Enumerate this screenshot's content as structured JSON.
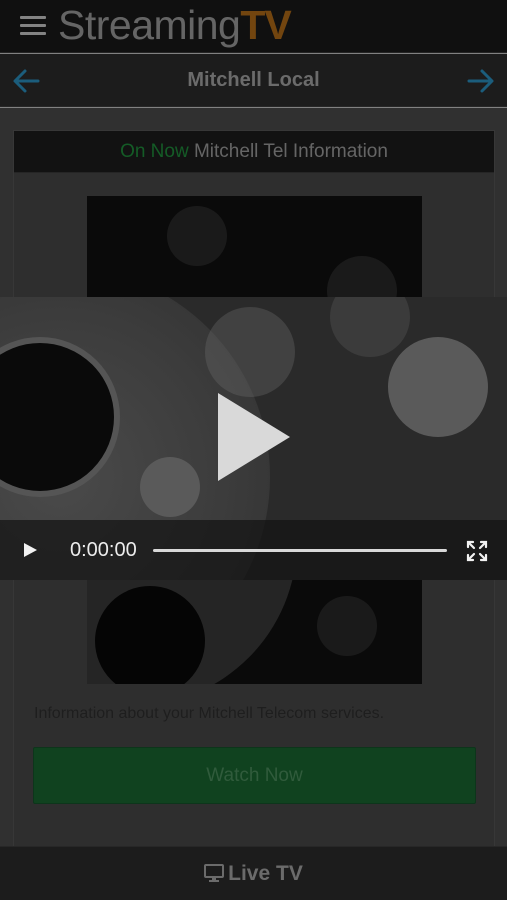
{
  "header": {
    "logo_prefix": "Streaming",
    "logo_suffix": "TV"
  },
  "nav": {
    "title": "Mitchell Local"
  },
  "card": {
    "on_now_label": "On Now",
    "program_title": "Mitchell Tel Information",
    "description": "Information about your Mitchell Telecom services.",
    "watch_button": "Watch Now"
  },
  "player": {
    "time": "0:00:00",
    "progress": 0
  },
  "footer": {
    "live_tv_label": "Live TV"
  },
  "icons": {
    "menu": "menu-icon",
    "back": "arrow-left-icon",
    "forward": "arrow-right-icon",
    "play": "play-icon",
    "fullscreen": "fullscreen-icon",
    "tv": "tv-icon"
  },
  "colors": {
    "logo_accent": "#b06b18",
    "on_now": "#1f8c3b",
    "watch_button": "#1a6630",
    "nav_arrow": "#2a8fbf"
  }
}
